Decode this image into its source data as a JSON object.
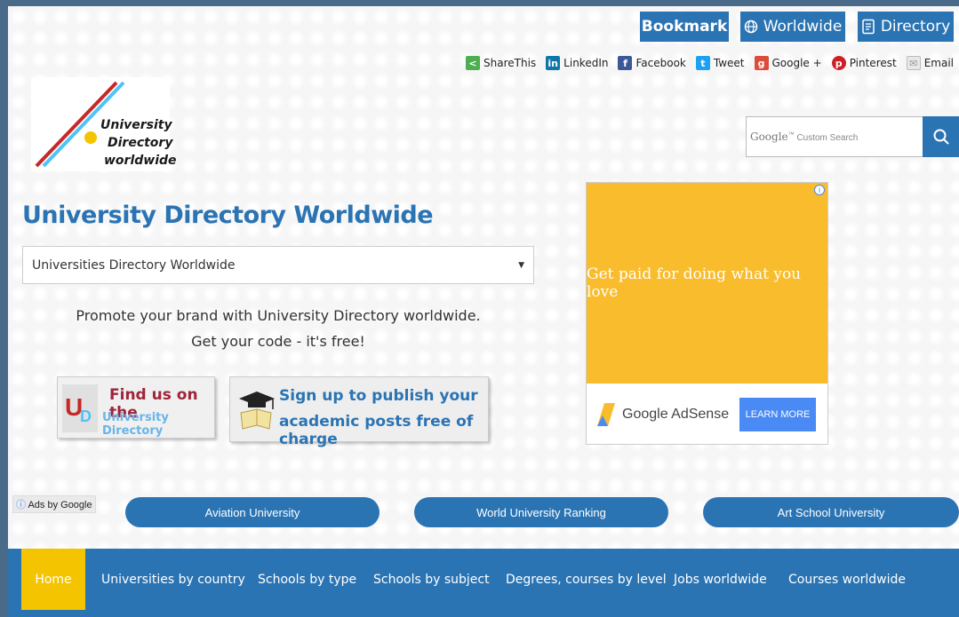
{
  "top_buttons": {
    "bookmark": "Bookmark",
    "worldwide": "Worldwide",
    "directory": "Directory"
  },
  "share": [
    {
      "label": "ShareThis",
      "icon": "share-icon",
      "color": "#4caf50"
    },
    {
      "label": "LinkedIn",
      "icon": "linkedin-icon",
      "color": "#0e76a8"
    },
    {
      "label": "Facebook",
      "icon": "facebook-icon",
      "color": "#3b5998"
    },
    {
      "label": "Tweet",
      "icon": "twitter-icon",
      "color": "#1da1f2"
    },
    {
      "label": "Google +",
      "icon": "google-plus-icon",
      "color": "#dd4b39"
    },
    {
      "label": "Pinterest",
      "icon": "pinterest-icon",
      "color": "#cb2027"
    },
    {
      "label": "Email",
      "icon": "email-icon",
      "color": "#999999"
    }
  ],
  "logo": {
    "line1": "University",
    "line2": "Directory",
    "line3": "worldwide"
  },
  "search": {
    "brand": "Google",
    "tm": "™",
    "placeholder": "Custom Search"
  },
  "page_title": "University Directory Worldwide",
  "select": {
    "value": "Universities Directory Worldwide"
  },
  "promo": {
    "line1": "Promote your brand with University Directory worldwide.",
    "line2": "Get your code - it's free!"
  },
  "badge1": {
    "title": "Find us on the",
    "sub": "University Directory",
    "logo_u": "U",
    "logo_d": "D"
  },
  "badge2": {
    "line1": "Sign up to publish your",
    "line2": "academic posts free of charge"
  },
  "ad": {
    "headline": "Get paid for doing what you love",
    "brand": "Google AdSense",
    "cta": "LEARN MORE"
  },
  "ads_by_google": "Ads by Google",
  "pills": [
    "Aviation University",
    "World University Ranking",
    "Art School University"
  ],
  "nav": [
    "Home",
    "Universities by country",
    "Schools by type",
    "Schools by subject",
    "Degrees, courses by level",
    "Jobs worldwide",
    "Courses worldwide"
  ],
  "colors": {
    "brand_blue": "#2b74b3",
    "active_yellow": "#f5c400",
    "ad_yellow": "#f9bc2c"
  }
}
